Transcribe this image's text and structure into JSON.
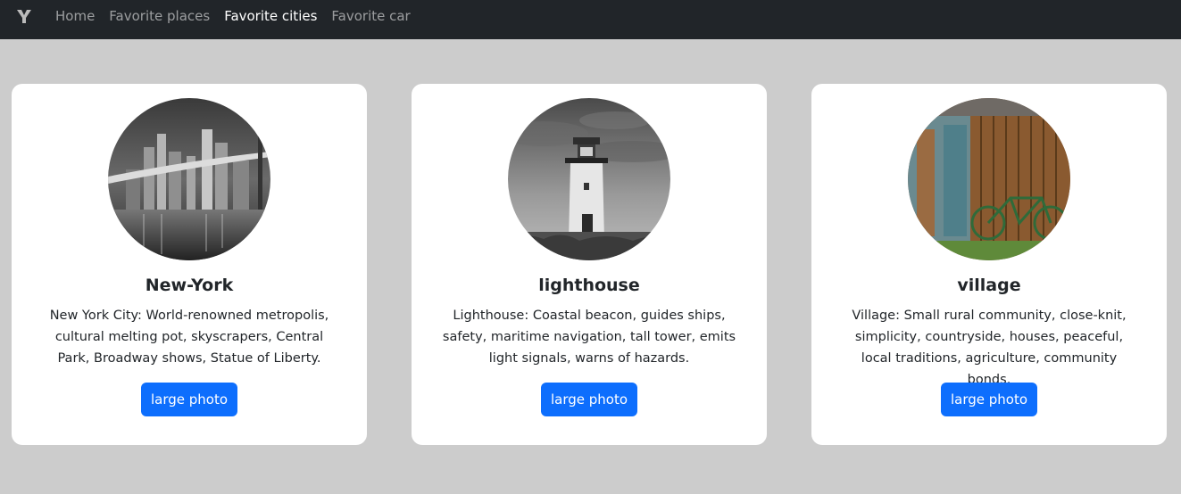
{
  "navbar": {
    "brand_icon": "y-logo-icon",
    "links": [
      {
        "label": "Home",
        "active": false
      },
      {
        "label": "Favorite places",
        "active": false
      },
      {
        "label": "Favorite cities",
        "active": true
      },
      {
        "label": "Favorite car",
        "active": false
      }
    ]
  },
  "cards": [
    {
      "title": "New-York",
      "text": "New York City: World-renowned metropolis, cultural melting pot, skyscrapers, Central Park, Broadway shows, Statue of Liberty.",
      "button": "large photo",
      "image": "new-york-bridge-night-image"
    },
    {
      "title": "lighthouse",
      "text": "Lighthouse: Coastal beacon, guides ships, safety, maritime navigation, tall tower, emits light signals, warns of hazards.",
      "button": "large photo",
      "image": "lighthouse-image"
    },
    {
      "title": "village",
      "text": "Village: Small rural community, close-knit, simplicity, countryside, houses, peaceful, local traditions, agriculture, community bonds.",
      "button": "large photo",
      "image": "village-barn-bicycle-image"
    }
  ],
  "colors": {
    "navbar_bg": "#212529",
    "page_bg": "#cccccc",
    "button_bg": "#0d6efd"
  }
}
